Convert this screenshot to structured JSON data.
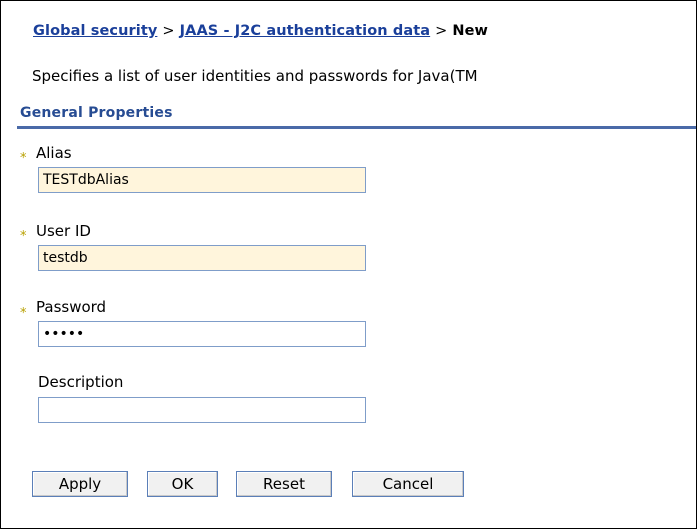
{
  "breadcrumb": {
    "link1": "Global security",
    "separator": ">",
    "link2": "JAAS - J2C authentication data",
    "current": "New"
  },
  "description": "Specifies a list of user identities and passwords for Java(TM",
  "section_title": "General Properties",
  "required_marker": "*",
  "fields": {
    "alias": {
      "label": "Alias",
      "value": "TESTdbAlias"
    },
    "user_id": {
      "label": "User ID",
      "value": "testdb"
    },
    "password": {
      "label": "Password",
      "value": "•••••"
    },
    "description": {
      "label": "Description",
      "value": ""
    }
  },
  "buttons": {
    "apply": "Apply",
    "ok": "OK",
    "reset": "Reset",
    "cancel": "Cancel"
  },
  "colors": {
    "link": "#1a3f9a",
    "section_title": "#274c93",
    "section_rule": "#4a6aa8",
    "required_star": "#b8a000",
    "filled_input_bg": "#fff5dc",
    "input_border": "#7f9dc9"
  }
}
